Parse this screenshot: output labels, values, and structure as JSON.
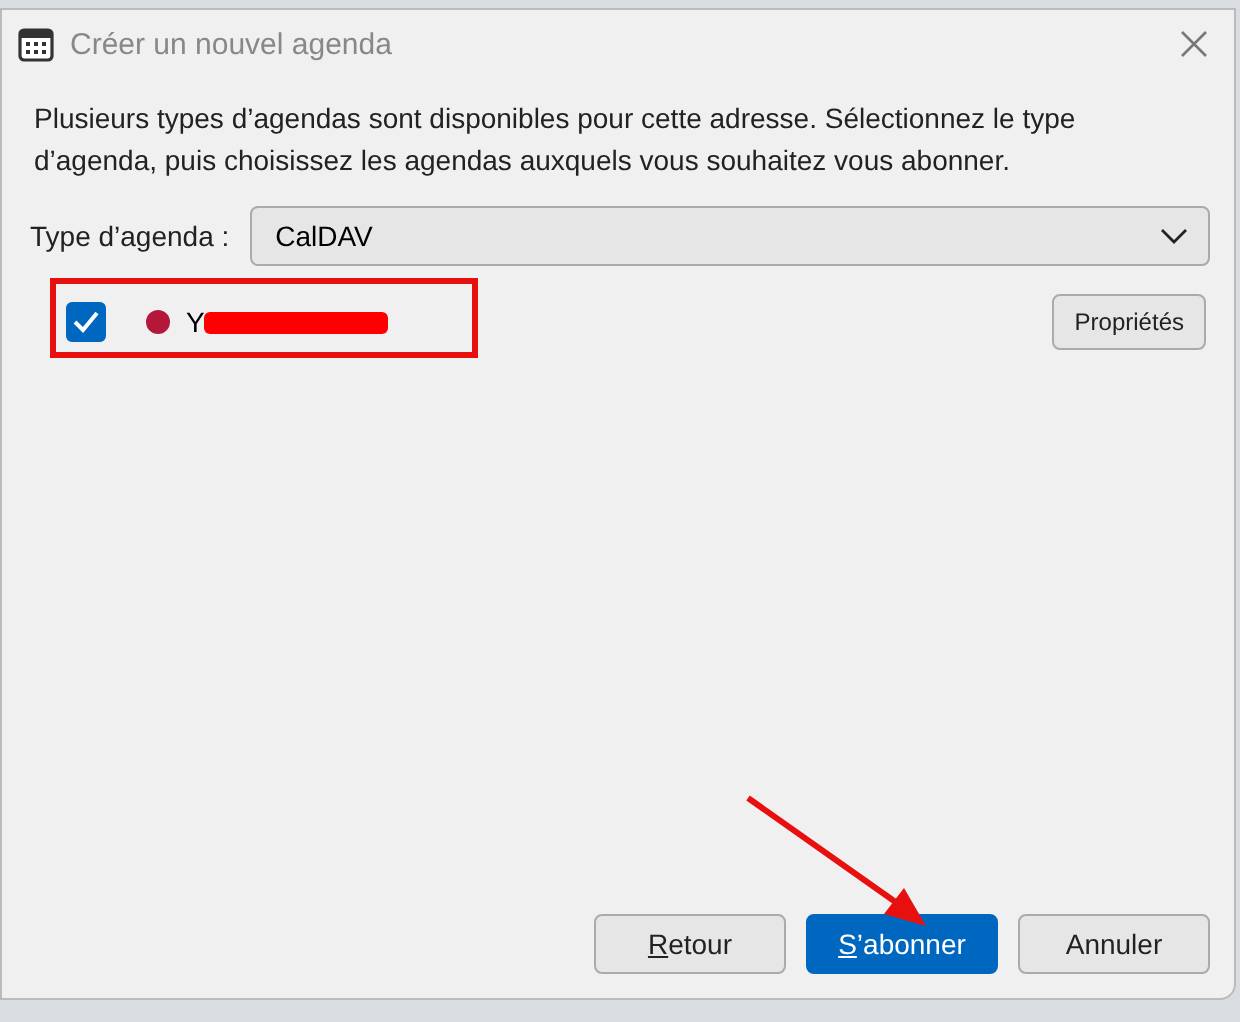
{
  "window": {
    "title": "Créer un nouvel agenda"
  },
  "description": "Plusieurs types d’agendas sont disponibles pour cette adresse. Sélectionnez le type d’agenda, puis choisissez les agendas auxquels vous souhaitez vous abonner.",
  "type_field": {
    "label": "Type d’agenda :",
    "value": "CalDAV"
  },
  "calendars": [
    {
      "name": "Y",
      "checked": true,
      "color": "#b5173a",
      "redacted": true,
      "button": "Propriétés"
    }
  ],
  "buttons": [
    {
      "label": "Retour",
      "underline_first": true,
      "primary": false
    },
    {
      "label": "S’abonner",
      "underline_first": true,
      "primary": true
    },
    {
      "label": "Annuler",
      "underline_first": false,
      "primary": false
    }
  ]
}
